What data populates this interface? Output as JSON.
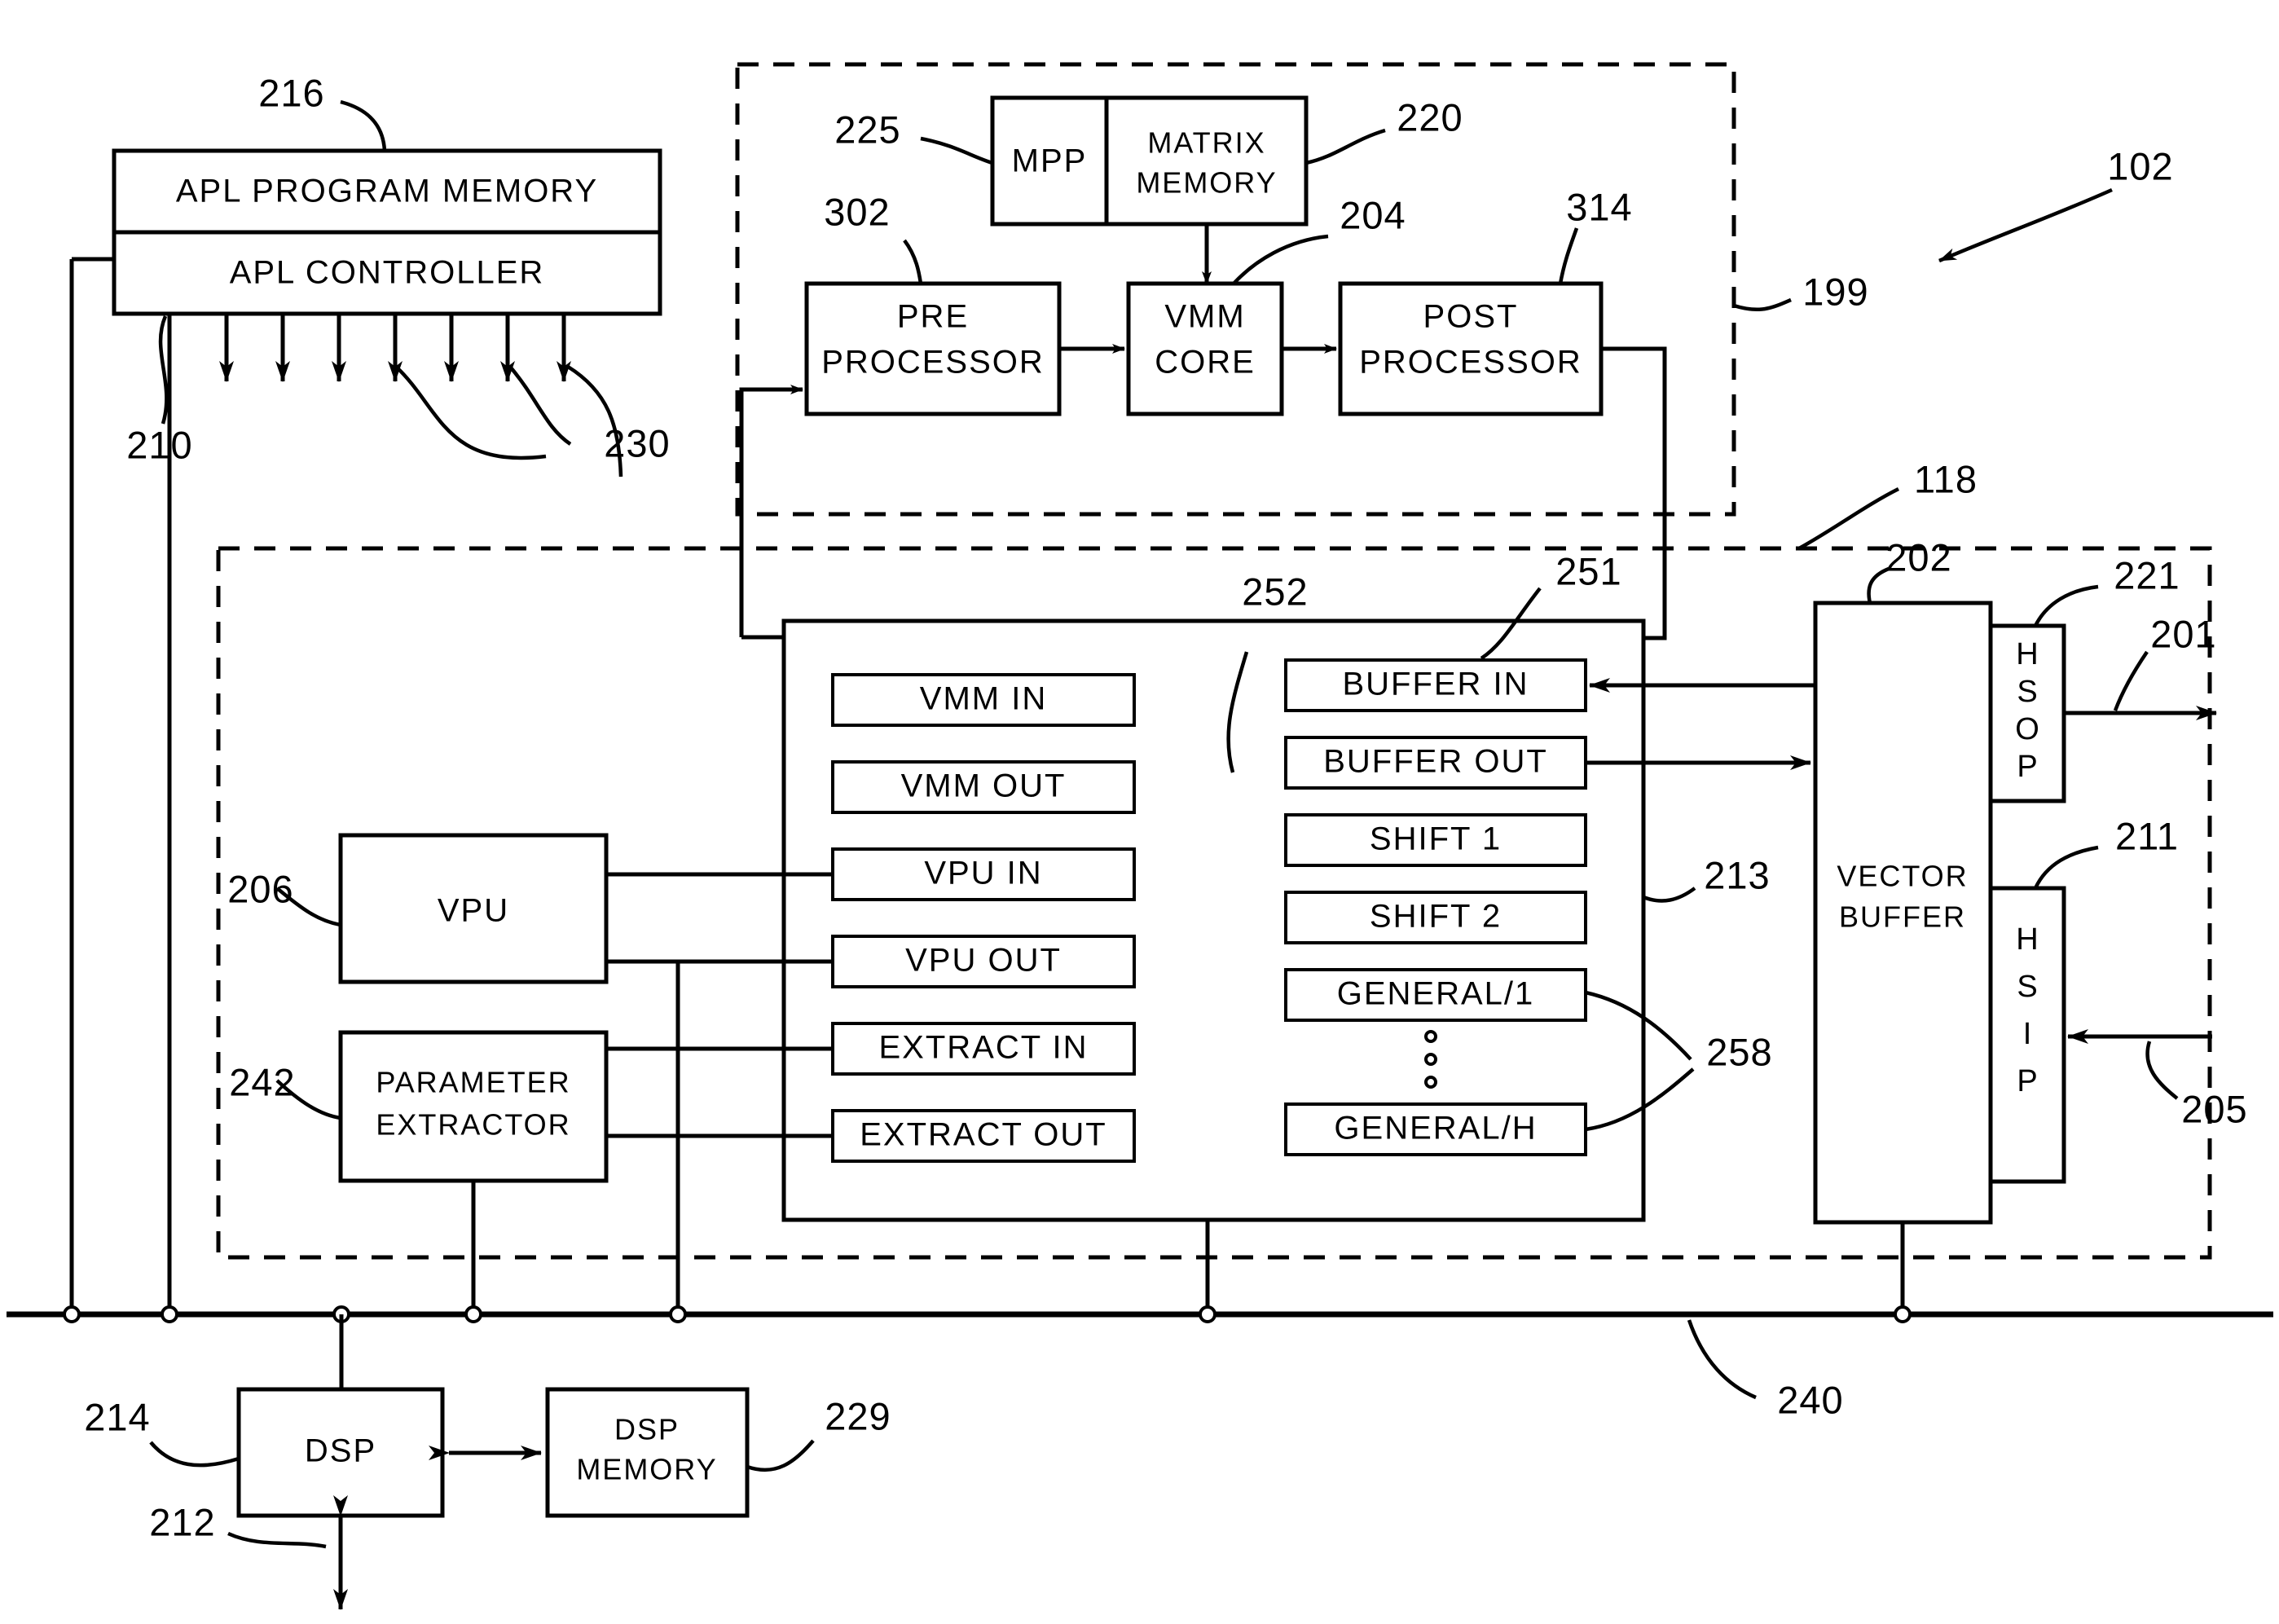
{
  "figure": {
    "domain": "patent-block-diagram",
    "title_ref": "102"
  },
  "blocks": {
    "apl_program_memory": "APL PROGRAM MEMORY",
    "apl_controller": "APL CONTROLLER",
    "mpp": "MPP",
    "matrix_memory": "MATRIX MEMORY",
    "matrix_memory_line1": "MATRIX",
    "matrix_memory_line2": "MEMORY",
    "pre_processor_line1": "PRE",
    "pre_processor_line2": "PROCESSOR",
    "vmm_core_line1": "VMM",
    "vmm_core_line2": "CORE",
    "post_processor_line1": "POST",
    "post_processor_line2": "PROCESSOR",
    "vpu": "VPU",
    "parameter_extractor_line1": "PARAMETER",
    "parameter_extractor_line2": "EXTRACTOR",
    "vector_buffer_line1": "VECTOR",
    "vector_buffer_line2": "BUFFER",
    "dsp": "DSP",
    "dsp_memory_line1": "DSP",
    "dsp_memory_line2": "MEMORY"
  },
  "registers_left": [
    "VMM IN",
    "VMM OUT",
    "VPU IN",
    "VPU OUT",
    "EXTRACT IN",
    "EXTRACT OUT"
  ],
  "registers_right": [
    "BUFFER IN",
    "BUFFER OUT",
    "SHIFT 1",
    "SHIFT 2",
    "GENERAL/1",
    "GENERAL/H"
  ],
  "registers_right_ellipsis": "◦ ◦ ◦",
  "ports": {
    "hsop_chars": [
      "H",
      "S",
      "O",
      "P"
    ],
    "hsip_chars": [
      "H",
      "S",
      "I",
      "P"
    ],
    "hsop": "HSOP",
    "hsip": "HSIP"
  },
  "reference_numerals": {
    "n102": "102",
    "n118": "118",
    "n199": "199",
    "n201": "201",
    "n202": "202",
    "n204": "204",
    "n205": "205",
    "n206": "206",
    "n210": "210",
    "n211": "211",
    "n212": "212",
    "n213": "213",
    "n214": "214",
    "n216": "216",
    "n220": "220",
    "n221": "221",
    "n225": "225",
    "n229": "229",
    "n230": "230",
    "n240": "240",
    "n242": "242",
    "n251": "251",
    "n252": "252",
    "n258": "258",
    "n302": "302",
    "n314": "314"
  },
  "colors": {
    "ink": "#000000",
    "paper": "#ffffff"
  }
}
